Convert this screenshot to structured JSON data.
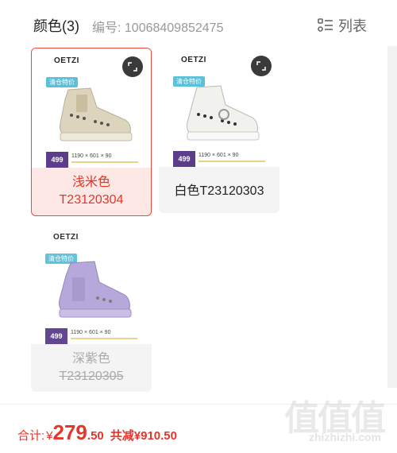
{
  "header": {
    "title": "颜色(3)",
    "sku_label": "编号: 10068409852475",
    "view_toggle_label": "列表"
  },
  "variants": [
    {
      "name_line1": "浅米色",
      "name_line2": "T23120304",
      "selected": true,
      "available": true,
      "color": "#d9d1b8",
      "image": {
        "brand": "OETZI",
        "promo": "清仓特价",
        "price": "499",
        "calc": "1190 × 601 × 90"
      }
    },
    {
      "name": "白色T23120303",
      "selected": false,
      "available": true,
      "color": "#ececec",
      "image": {
        "brand": "OETZI",
        "promo": "清仓特价",
        "price": "499",
        "calc": "1190 × 601 × 90"
      }
    },
    {
      "name_line1": "深紫色",
      "name_line2": "T23120305",
      "selected": false,
      "available": false,
      "color": "#a999cf",
      "image": {
        "brand": "OETZI",
        "promo": "清仓特价",
        "price": "499",
        "calc": "1190 × 601 × 90"
      }
    }
  ],
  "footer": {
    "total_label": "合计:",
    "currency": "¥",
    "total_int": "279",
    "total_dec": ".50",
    "savings": "共减¥910.50"
  },
  "watermark": {
    "chars": "值值值",
    "url": "zhizhizhi.com"
  },
  "colors": {
    "accent": "#e4362a",
    "selected_bg": "#fde8e6",
    "card_bg": "#f4f4f4",
    "price_tag": "#5b3d8c",
    "promo": "#5bc0d8"
  },
  "icons": {
    "view_toggle": "list-icon",
    "zoom": "expand-icon"
  }
}
